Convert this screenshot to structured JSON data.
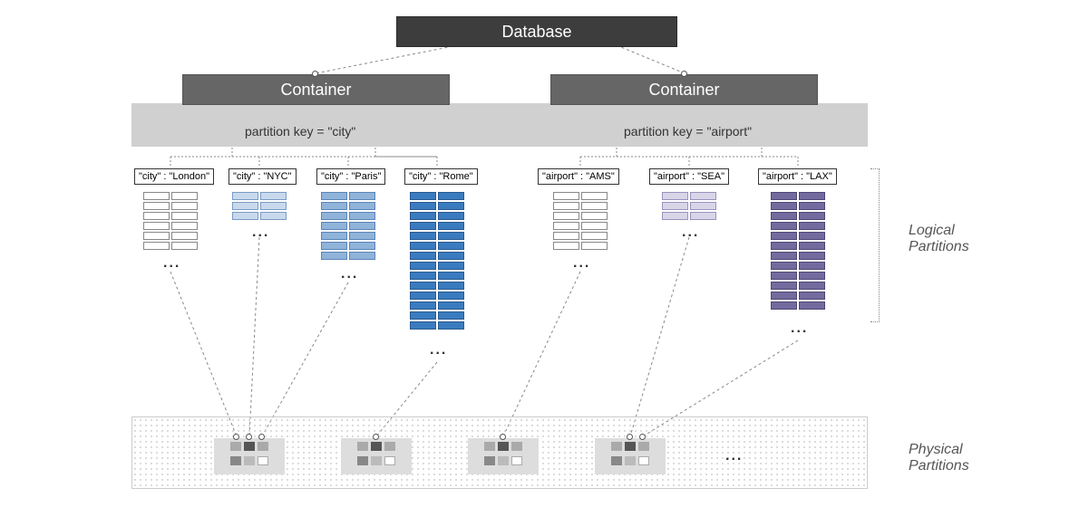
{
  "database": {
    "label": "Database"
  },
  "containers": [
    {
      "label": "Container",
      "partition_key_label": "partition key = \"city\"",
      "partitions": [
        {
          "label": "\"city\" : \"London\"",
          "rows": 6,
          "color": "#ffffff",
          "border": "#888"
        },
        {
          "label": "\"city\" : \"NYC\"",
          "rows": 3,
          "color": "#c9d9ed",
          "border": "#7a9bc4"
        },
        {
          "label": "\"city\" : \"Paris\"",
          "rows": 7,
          "color": "#8fb3d9",
          "border": "#5b86b8"
        },
        {
          "label": "\"city\" : \"Rome\"",
          "rows": 14,
          "color": "#3a7bbf",
          "border": "#2a5a8f"
        }
      ]
    },
    {
      "label": "Container",
      "partition_key_label": "partition key = \"airport\"",
      "partitions": [
        {
          "label": "\"airport\" : \"AMS\"",
          "rows": 6,
          "color": "#ffffff",
          "border": "#888"
        },
        {
          "label": "\"airport\" : \"SEA\"",
          "rows": 3,
          "color": "#d9d5e8",
          "border": "#9a92bd"
        },
        {
          "label": "\"airport\" : \"LAX\"",
          "rows": 12,
          "color": "#736a9e",
          "border": "#4f4875"
        }
      ]
    }
  ],
  "side_labels": {
    "logical": "Logical\nPartitions",
    "physical": "Physical\nPartitions"
  },
  "ellipsis": "..."
}
